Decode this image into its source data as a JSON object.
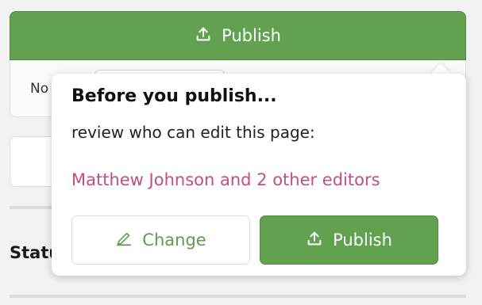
{
  "top_publish": {
    "label": "Publish",
    "icon": "upload-icon"
  },
  "sub_panel": {
    "text": "No"
  },
  "status": {
    "label": "Status"
  },
  "popover": {
    "title": "Before you publish...",
    "body": "review who can edit this page:",
    "editors_link": "Matthew Johnson and 2 other editors",
    "change_label": "Change",
    "change_icon": "pencil-icon",
    "publish_label": "Publish",
    "publish_icon": "upload-icon"
  },
  "colors": {
    "accent_green": "#62a150",
    "link_pink": "#c04f84",
    "page_bg": "#f2f2f2"
  }
}
